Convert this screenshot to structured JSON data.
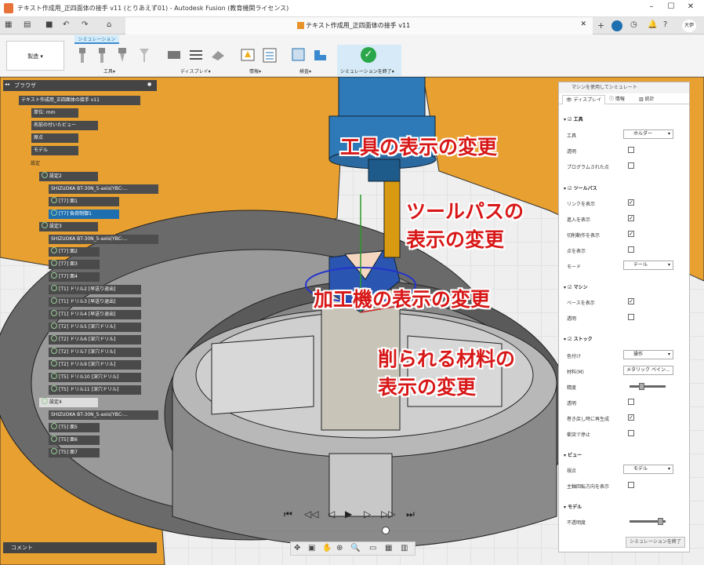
{
  "window": {
    "title": "テキスト作成用_正四面体の接手 v11 (とりあえず01) - Autodesk Fusion (教育機関ライセンス)"
  },
  "document_tab": {
    "name": "テキスト作成用_正四面体の接手 v11"
  },
  "user": {
    "initials": "大伊"
  },
  "ribbon": {
    "workspace": "製造",
    "active_tab": "シミュレーション",
    "groups": [
      "工具",
      "ディスプレイ",
      "情報",
      "検査",
      "シミュレーションを終了"
    ]
  },
  "browser": {
    "title": "ブラウザ",
    "items": [
      {
        "label": "テキスト作成用_正四面体の接手 v11"
      },
      {
        "label": "単位: mm"
      },
      {
        "label": "名前の付いたビュー"
      },
      {
        "label": "原点"
      },
      {
        "label": "モデル"
      },
      {
        "label": "設定"
      },
      {
        "label": "設定2"
      },
      {
        "label": "SHIZUOKA BT-30N_5-axis(YBC-..."
      },
      {
        "label": "[T7] 面1"
      },
      {
        "label": "[T7] 負荷制御1"
      },
      {
        "label": "設定3"
      },
      {
        "label": "SHIZUOKA BT-30N_5-axis(YBC-..."
      },
      {
        "label": "[T7] 面2"
      },
      {
        "label": "[T7] 面3"
      },
      {
        "label": "[T7] 面4"
      },
      {
        "label": "[T1] ドリル2 [早送り退出]"
      },
      {
        "label": "[T1] ドリル3 [早送り退出]"
      },
      {
        "label": "[T1] ドリル4 [早送り退出]"
      },
      {
        "label": "[T2] ドリル5 [深穴ドリル]"
      },
      {
        "label": "[T2] ドリル6 [深穴ドリル]"
      },
      {
        "label": "[T2] ドリル7 [深穴ドリル]"
      },
      {
        "label": "[T2] ドリル9 [深穴ドリル]"
      },
      {
        "label": "[T5] ドリル10 [深穴ドリル]"
      },
      {
        "label": "[T5] ドリル11 [深穴ドリル]"
      },
      {
        "label": "設定4"
      },
      {
        "label": "SHIZUOKA BT-30N_5-axis(YBC-..."
      },
      {
        "label": "[T5] 面5"
      },
      {
        "label": "[T5] 面6"
      },
      {
        "label": "[T5] 面7"
      }
    ],
    "comment": "コメント"
  },
  "panel": {
    "title": "マシンを使用してシミュレート",
    "tabs": [
      "ディスプレイ",
      "情報",
      "統計"
    ],
    "tool": {
      "header": "工具",
      "tool_label": "工具",
      "tool_value": "ホルダー",
      "transparent": "透明",
      "programmed": "プログラムされた点"
    },
    "toolpath": {
      "header": "ツールパス",
      "links": "リンクを表示",
      "approach": "進入を表示",
      "cutting": "切削動作を表示",
      "points": "点を表示",
      "mode_label": "モード",
      "mode_value": "テール"
    },
    "machine": {
      "header": "マシン",
      "base": "ベースを表示",
      "transparent": "透明"
    },
    "stock": {
      "header": "ストック",
      "color_label": "色付け",
      "color_value": "操作",
      "material_label": "材料(M)",
      "material_value": "メタリック ペイン...",
      "accuracy": "精度",
      "transparent": "透明",
      "regen": "巻き戻し時に再生成",
      "collision": "衝突で停止"
    },
    "view": {
      "header": "ビュー",
      "viewpoint_label": "視点",
      "viewpoint_value": "モデル",
      "spindle": "主軸回転方向を表示"
    },
    "model": {
      "header": "モデル",
      "opacity": "不透明度"
    },
    "finish_button": "シミュレーションを終了"
  },
  "annotations": {
    "tool": "工具の表示の変更",
    "toolpath_1": "ツールパスの",
    "toolpath_2": "表示の変更",
    "machine": "加工機の表示の変更",
    "stock_1": "削られる材料の",
    "stock_2": "表示の変更"
  },
  "colors": {
    "accent": "#1e6fb0",
    "annotation": "#d81818",
    "fixture": "#e8a030",
    "spindle": "#2e7ab8"
  }
}
